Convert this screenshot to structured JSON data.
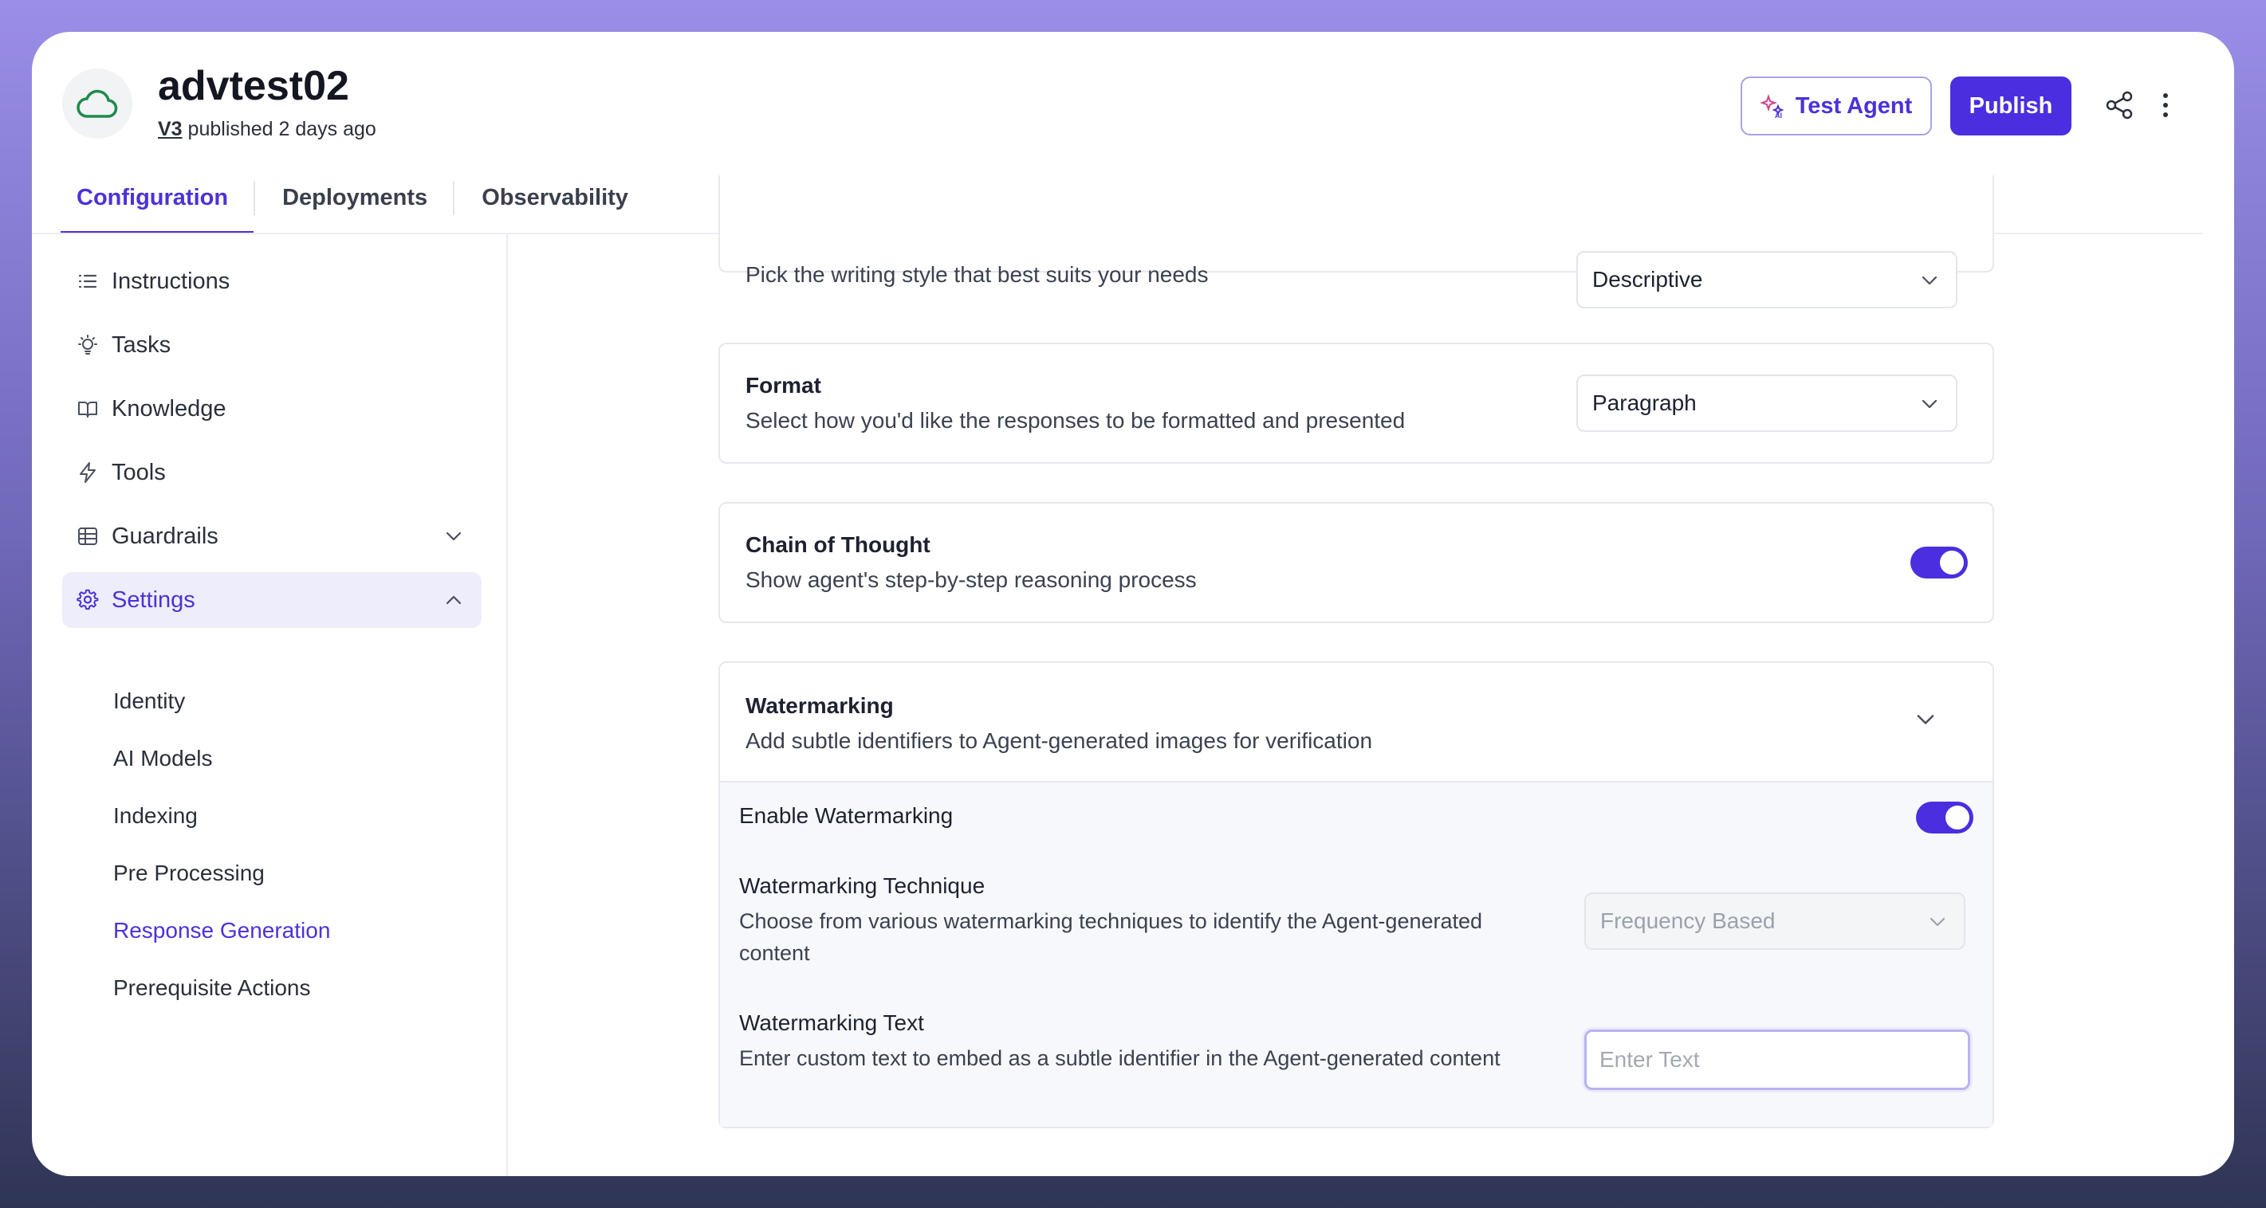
{
  "agent": {
    "name": "advtest02",
    "version": "V3",
    "published": "published 2 days ago"
  },
  "header": {
    "test_agent_label": "Test Agent",
    "publish_label": "Publish"
  },
  "tabs": [
    {
      "label": "Configuration",
      "active": true
    },
    {
      "label": "Deployments",
      "active": false
    },
    {
      "label": "Observability",
      "active": false
    }
  ],
  "sidebar": {
    "items": [
      {
        "label": "Instructions",
        "icon": "list-icon"
      },
      {
        "label": "Tasks",
        "icon": "lightbulb-icon"
      },
      {
        "label": "Knowledge",
        "icon": "book-icon"
      },
      {
        "label": "Tools",
        "icon": "lightning-icon"
      },
      {
        "label": "Guardrails",
        "icon": "table-icon"
      },
      {
        "label": "Settings",
        "icon": "gear-icon"
      }
    ],
    "settings_sub": [
      {
        "label": "Identity"
      },
      {
        "label": "AI Models"
      },
      {
        "label": "Indexing"
      },
      {
        "label": "Pre Processing"
      },
      {
        "label": "Response Generation",
        "active": true
      },
      {
        "label": "Prerequisite Actions"
      }
    ]
  },
  "main": {
    "style": {
      "description": "Pick the writing style that best suits your needs",
      "value": "Descriptive"
    },
    "format": {
      "title": "Format",
      "description": "Select how you'd like the responses to be formatted and presented",
      "value": "Paragraph"
    },
    "chain_of_thought": {
      "title": "Chain of Thought",
      "description": "Show agent's step-by-step reasoning process",
      "enabled": true
    },
    "watermarking": {
      "title": "Watermarking",
      "description": "Add subtle identifiers to Agent-generated images for verification",
      "enable_label": "Enable Watermarking",
      "enabled": true,
      "technique_label": "Watermarking Technique",
      "technique_desc": "Choose from various watermarking techniques to identify the Agent-generated content",
      "technique_value": "Frequency Based",
      "text_label": "Watermarking Text",
      "text_desc": "Enter custom text to embed as a subtle identifier in the Agent-generated content",
      "text_placeholder": "Enter Text",
      "text_value": ""
    }
  },
  "colors": {
    "accent": "#4a2ee0",
    "accent_light": "#eeedfb",
    "logo_stroke": "#1f8a4c"
  }
}
